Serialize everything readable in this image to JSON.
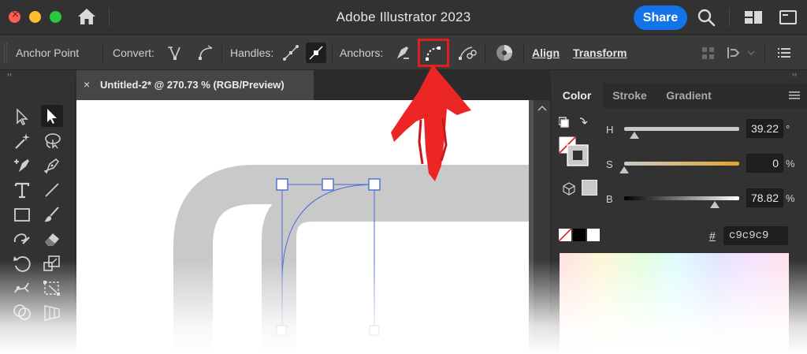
{
  "app": {
    "title": "Adobe Illustrator 2023"
  },
  "titlebar": {
    "share_label": "Share"
  },
  "controlbar": {
    "context_label": "Anchor Point",
    "convert_label": "Convert:",
    "handles_label": "Handles:",
    "anchors_label": "Anchors:",
    "align_label": "Align",
    "transform_label": "Transform"
  },
  "document": {
    "tab_title": "Untitled-2* @ 270.73 % (RGB/Preview)",
    "close_glyph": "×"
  },
  "collapse": {
    "left": "‹‹",
    "right": "››"
  },
  "color_panel": {
    "tabs": [
      {
        "label": "Color"
      },
      {
        "label": "Stroke"
      },
      {
        "label": "Gradient"
      }
    ],
    "sliders": [
      {
        "label": "H",
        "value": "39.22",
        "unit": "°",
        "position": 0.09
      },
      {
        "label": "S",
        "value": "0",
        "unit": "%",
        "position": 0.0
      },
      {
        "label": "B",
        "value": "78.82",
        "unit": "%",
        "position": 0.79
      }
    ],
    "hex_symbol": "#",
    "hex_value": "c9c9c9"
  },
  "colors": {
    "accent": "#1473e6",
    "highlight": "#e41e1e",
    "path_gray": "#c9c9c9",
    "selection_blue": "#4a6cd4"
  }
}
